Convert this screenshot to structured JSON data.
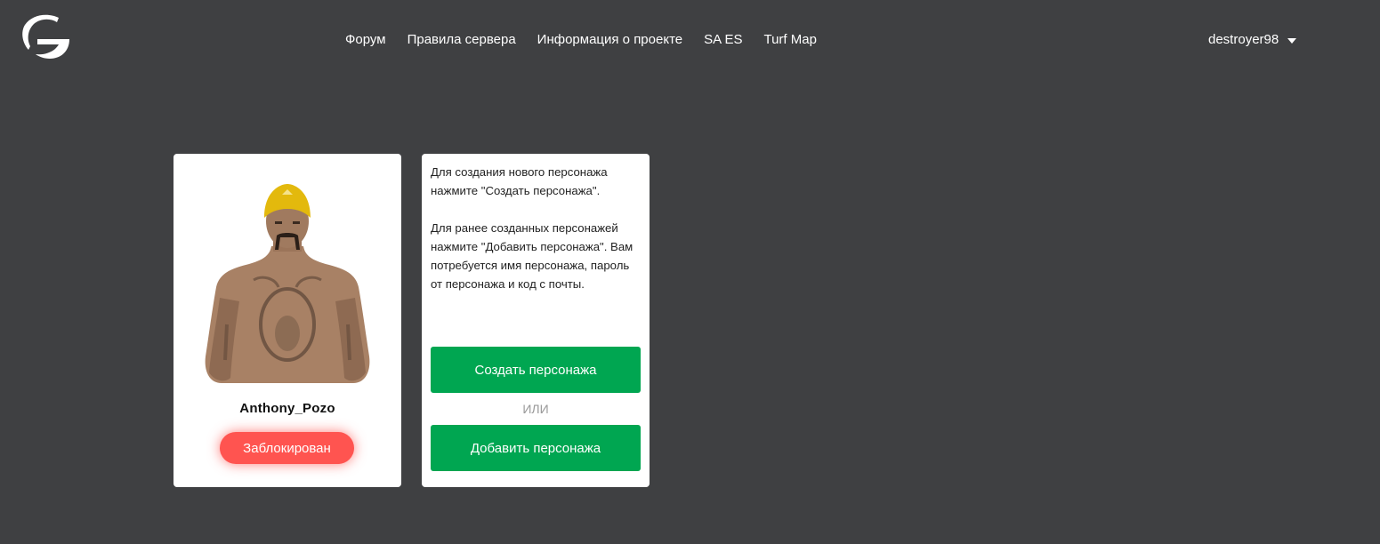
{
  "header": {
    "logo_icon": "g-logo-icon",
    "nav": [
      {
        "label": "Форум"
      },
      {
        "label": "Правила сервера"
      },
      {
        "label": "Информация о проекте"
      },
      {
        "label": "SA ES"
      },
      {
        "label": "Turf Map"
      }
    ],
    "user": {
      "name": "destroyer98",
      "dropdown_icon": "caret-down-icon"
    }
  },
  "character": {
    "name": "Anthony_Pozo",
    "status": "Заблокирован",
    "status_color": "#ff5450"
  },
  "info": {
    "paragraph1": "Для создания нового персонажа нажмите \"Создать персонажа\".",
    "paragraph2": "Для ранее созданных персонажей нажмите \"Добавить персонажа\". Вам потребуется имя персонажа, пароль от персонажа и код с почты.",
    "create_label": "Создать персонажа",
    "or_label": "ИЛИ",
    "add_label": "Добавить персонажа",
    "accent_color": "#00a651"
  }
}
